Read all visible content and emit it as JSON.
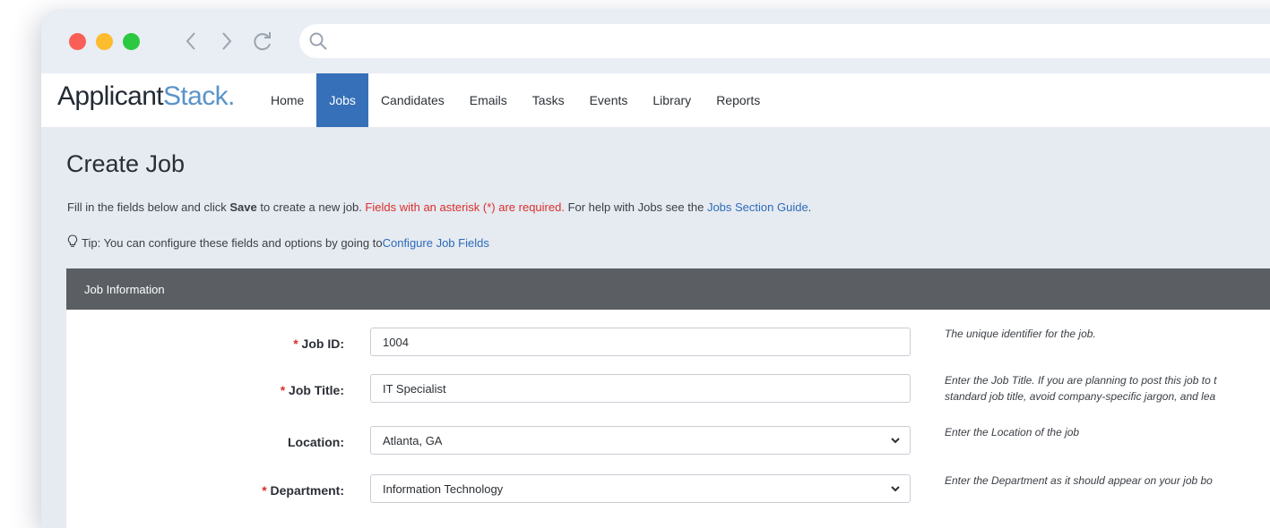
{
  "browser": {
    "controls": [
      "close",
      "minimize",
      "maximize"
    ],
    "icons": {
      "back": "chevron-left-icon",
      "forward": "chevron-right-icon",
      "reload": "reload-icon",
      "search": "search-icon"
    }
  },
  "app": {
    "logo_part1": "Applicant",
    "logo_part2": "Stack",
    "logo_dot": ".",
    "nav": [
      "Home",
      "Jobs",
      "Candidates",
      "Emails",
      "Tasks",
      "Events",
      "Library",
      "Reports"
    ],
    "active_nav": "Jobs"
  },
  "page": {
    "title": "Create Job",
    "intro_1": "Fill in the fields below and click ",
    "intro_save": "Save",
    "intro_2": " to create a new job. ",
    "intro_required": "Fields with an asterisk (*) are required.",
    "intro_3": " For help with Jobs see the ",
    "intro_link": "Jobs Section Guide",
    "intro_4": ".",
    "tip_text": "Tip: You can configure these fields and options by going to ",
    "tip_link": "Configure Job Fields"
  },
  "panel": {
    "title": "Job Information",
    "fields": [
      {
        "required": true,
        "label": "Job ID:",
        "value": "1004",
        "type": "text",
        "help": [
          "The unique identifier for the job."
        ]
      },
      {
        "required": true,
        "label": "Job Title:",
        "value": "IT Specialist",
        "type": "text",
        "help": [
          "Enter the Job Title. If you are planning to post this job to t",
          "standard job title, avoid company-specific jargon, and lea"
        ]
      },
      {
        "required": false,
        "label": "Location:",
        "value": "Atlanta, GA",
        "type": "select",
        "help": [
          "Enter the Location of the job"
        ]
      },
      {
        "required": true,
        "label": "Department:",
        "value": "Information Technology",
        "type": "select",
        "help": [
          "Enter the Department as it should appear on your job bo"
        ]
      }
    ]
  },
  "colors": {
    "accent": "#3670b8",
    "required": "#d9302c",
    "link": "#2c6cb8",
    "panel_header": "#5b5f63",
    "page_bg": "#e6eaf1"
  }
}
